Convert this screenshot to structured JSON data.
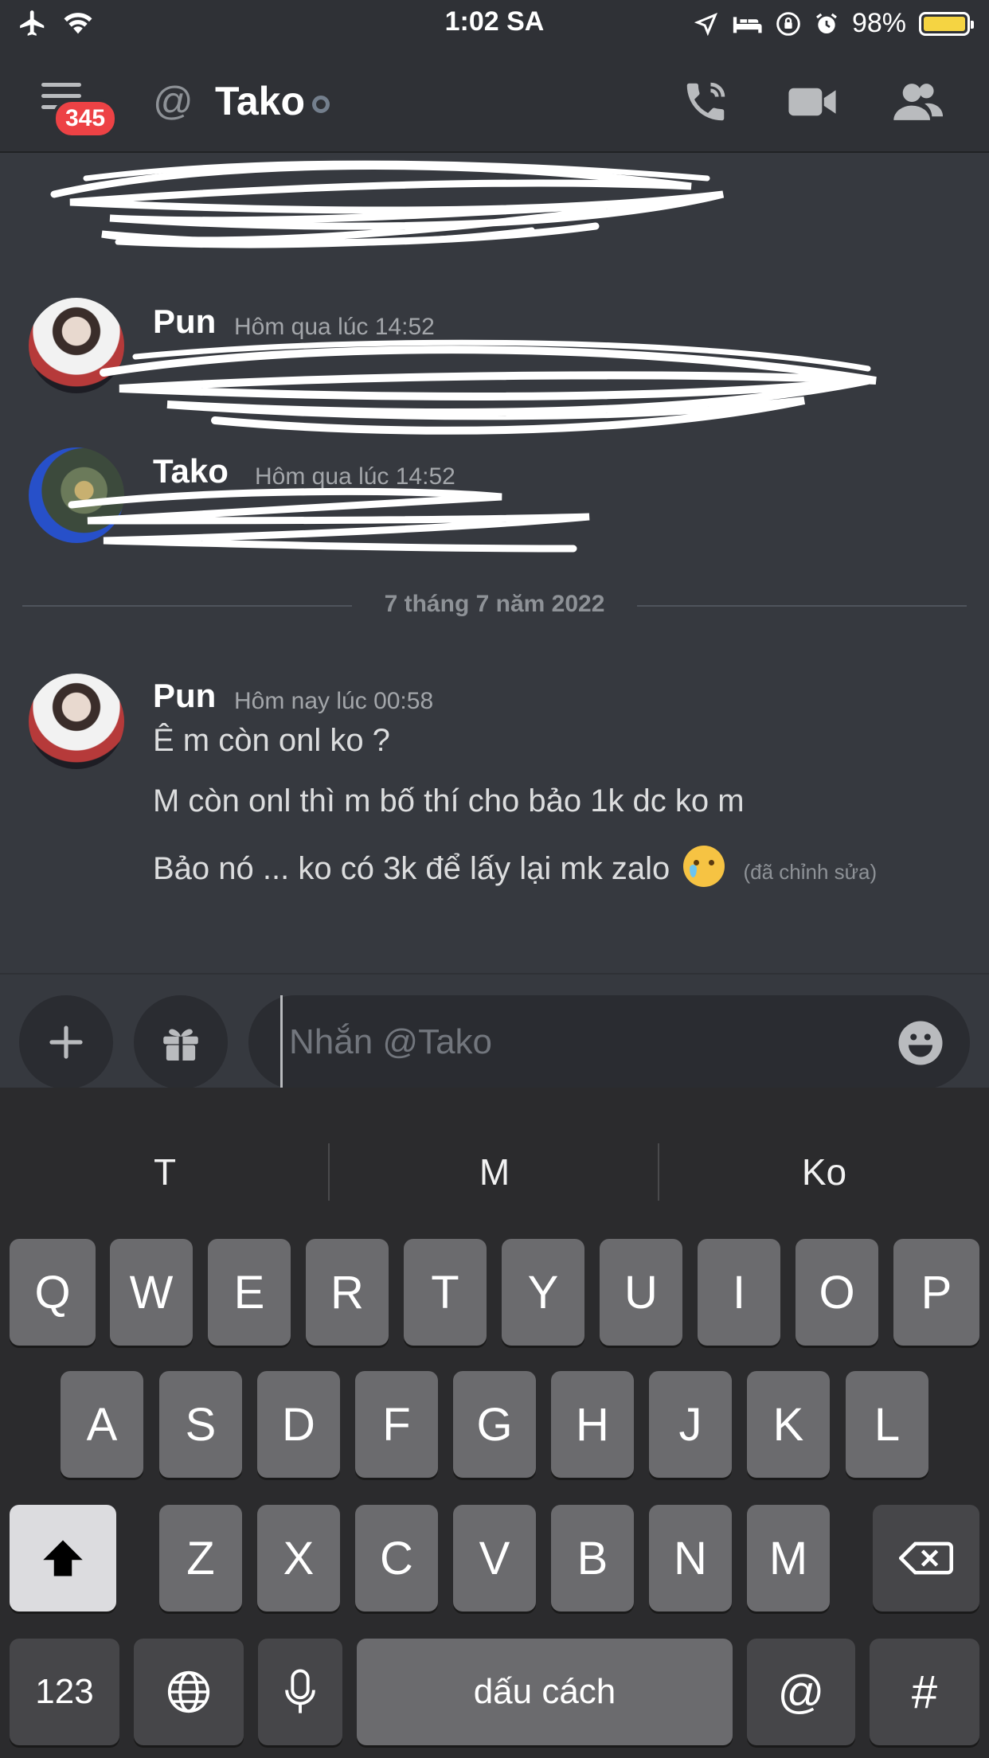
{
  "status_bar": {
    "time": "1:02 SA",
    "battery": "98%",
    "battery_color": "#f5d442"
  },
  "header": {
    "menu_icon": "hamburger-menu-icon",
    "unread_badge": "345",
    "channel_prefix_icon": "at-icon",
    "channel_prefix": "@",
    "title": "Tako",
    "actions": [
      "call-icon",
      "video-icon",
      "members-icon"
    ]
  },
  "messages": {
    "group1": {
      "author": "Pun",
      "timestamp": "Hôm qua lúc 14:52"
    },
    "group2": {
      "author": "Tako",
      "timestamp": "Hôm qua lúc 14:52"
    },
    "date_divider": "7 tháng 7 năm 2022",
    "group3": {
      "author": "Pun",
      "timestamp": "Hôm nay lúc 00:58",
      "lines": [
        "Ê m còn onl ko ?",
        "M còn onl thì m bố thí cho bảo 1k dc ko m",
        "Bảo nó ... ko có 3k để lấy lại mk zalo"
      ],
      "edited": "(đã chỉnh sửa)"
    }
  },
  "composer": {
    "placeholder": "Nhắn @Tako",
    "value": "",
    "add_icon": "plus-icon",
    "gift_icon": "gift-icon",
    "emoji_icon": "smiley-icon"
  },
  "keyboard": {
    "suggestions": [
      "T",
      "M",
      "Ko"
    ],
    "row1": [
      "Q",
      "W",
      "E",
      "R",
      "T",
      "Y",
      "U",
      "I",
      "O",
      "P"
    ],
    "row2": [
      "A",
      "S",
      "D",
      "F",
      "G",
      "H",
      "J",
      "K",
      "L"
    ],
    "row3": [
      "Z",
      "X",
      "C",
      "V",
      "B",
      "N",
      "M"
    ],
    "numbers": "123",
    "space": "dấu cách",
    "at": "@",
    "hash": "#"
  },
  "colors": {
    "background": "#36393f",
    "header": "#2f3136",
    "badge": "#ed4245",
    "keyboard": "#2b2b2d"
  }
}
